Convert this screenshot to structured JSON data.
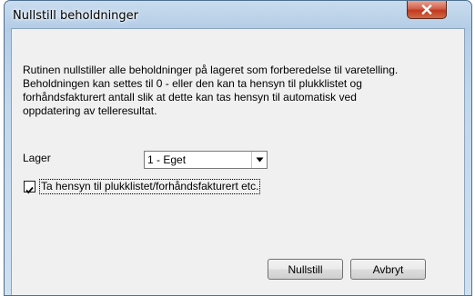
{
  "window": {
    "title": "Nullstill beholdninger",
    "close_icon": "close-x-icon"
  },
  "description": "Rutinen nullstiller alle beholdninger på lageret som forberedelse til varetelling.\n Beholdningen kan settes til 0 - eller den kan ta hensyn til plukklistet og\nforhåndsfakturert antall slik at dette kan tas hensyn til automatisk ved\noppdatering av telleresultat.",
  "lager": {
    "label": "Lager",
    "selected": "1 - Eget",
    "dropdown_icon": "chevron-down-icon"
  },
  "checkbox": {
    "label": "Ta hensyn til plukklistet/forhåndsfakturert etc.",
    "checked": true
  },
  "buttons": {
    "ok_label": "Nullstill",
    "cancel_label": "Avbryt"
  },
  "colors": {
    "titlebar": "#b4cde6",
    "close_button": "#c2381d",
    "client_background": "#f0f0f0"
  }
}
